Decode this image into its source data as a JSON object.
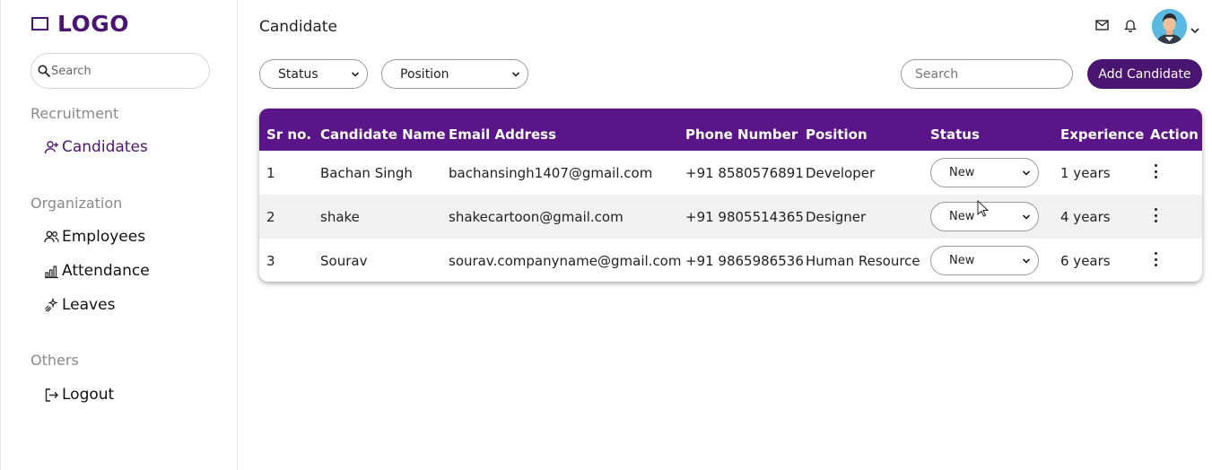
{
  "brand": {
    "logo_text": "LOGO",
    "color": "#4a1570"
  },
  "sidebar": {
    "search_placeholder": "Search",
    "sections": [
      {
        "label": "Recruitment",
        "items": [
          {
            "label": "Candidates",
            "icon": "user-plus-icon",
            "active": true
          }
        ]
      },
      {
        "label": "Organization",
        "items": [
          {
            "label": "Employees",
            "icon": "users-icon"
          },
          {
            "label": "Attendance",
            "icon": "bar-chart-icon"
          },
          {
            "label": "Leaves",
            "icon": "sparkles-icon"
          }
        ]
      },
      {
        "label": "Others",
        "items": [
          {
            "label": "Logout",
            "icon": "logout-icon"
          }
        ]
      }
    ]
  },
  "header": {
    "title": "Candidate",
    "icons": [
      "mail-icon",
      "bell-icon"
    ],
    "avatar": "user-avatar"
  },
  "toolbar": {
    "status_filter": "Status",
    "position_filter": "Position",
    "search_placeholder": "Search",
    "add_label": "Add Candidate"
  },
  "table": {
    "header_color": "#5a1588",
    "columns": [
      "Sr no.",
      "Candidate Name",
      "Email Address",
      "Phone Number",
      "Position",
      "Status",
      "Experience",
      "Action"
    ],
    "rows": [
      {
        "sr": "1",
        "name": "Bachan Singh",
        "email": "bachansingh1407@gmail.com",
        "phone": "+91 8580576891",
        "position": "Developer",
        "status": "New",
        "experience": "1 years"
      },
      {
        "sr": "2",
        "name": "shake",
        "email": "shakecartoon@gmail.com",
        "phone": "+91 9805514365",
        "position": "Designer",
        "status": "New",
        "experience": "4 years"
      },
      {
        "sr": "3",
        "name": "Sourav",
        "email": "sourav.companyname@gmail.com",
        "phone": "+91 9865986536",
        "position": "Human Resource",
        "status": "New",
        "experience": "6 years"
      }
    ]
  }
}
